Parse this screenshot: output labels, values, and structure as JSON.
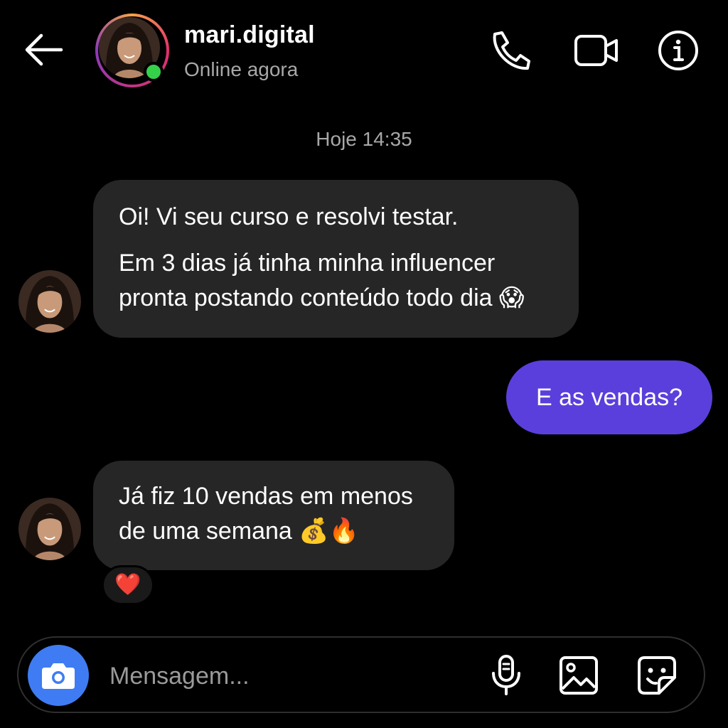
{
  "header": {
    "username": "mari.digital",
    "status": "Online agora",
    "online_color": "#35d14a",
    "icons": {
      "back": "arrow-left-icon",
      "call": "phone-icon",
      "video": "video-camera-icon",
      "info": "info-icon"
    }
  },
  "chat": {
    "timestamp": "Hoje 14:35",
    "messages": [
      {
        "direction": "incoming",
        "lines": [
          "Oi! Vi seu curso e resolvi testar.",
          "Em 3 dias já tinha minha influencer",
          "pronta postando conteúdo todo dia 😱"
        ]
      },
      {
        "direction": "outgoing",
        "text": "E as vendas?"
      },
      {
        "direction": "incoming",
        "lines": [
          "Já fiz 10 vendas em menos",
          "de uma semana 💰🔥"
        ],
        "reaction": "❤️"
      }
    ]
  },
  "composer": {
    "placeholder": "Mensagem...",
    "icons": {
      "camera": "camera-icon",
      "mic": "microphone-icon",
      "gallery": "image-icon",
      "sticker": "sticker-icon"
    }
  },
  "colors": {
    "background": "#000000",
    "incoming_bubble": "#262626",
    "outgoing_bubble": "#5b3fdc",
    "camera_button": "#3f7cf3"
  }
}
